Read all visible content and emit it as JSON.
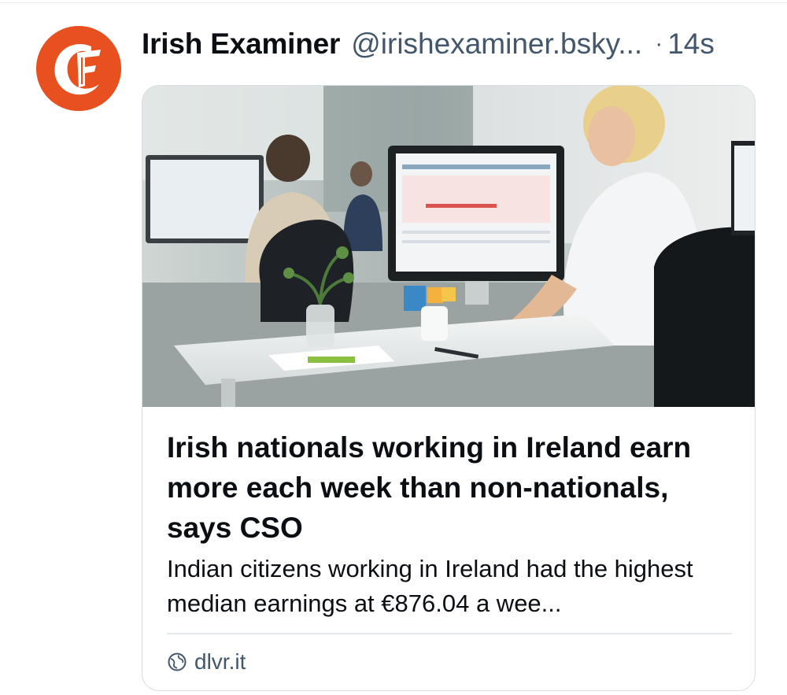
{
  "post": {
    "author_name": "Irish Examiner",
    "author_handle": "@irishexaminer.bsky...",
    "separator": "·",
    "timestamp": "14s",
    "avatar_icon": "irish-examiner-logo",
    "avatar_color": "#e8501f"
  },
  "link_card": {
    "image_icon": "office-workers-photo",
    "title": "Irish nationals working in Ireland earn more each week than non-nationals, says CSO",
    "description": "Indian citizens working in Ireland had the highest median earnings at €876.04 a wee...",
    "domain_icon": "globe-icon",
    "domain": "dlvr.it"
  },
  "colors": {
    "text_primary": "#0b0f14",
    "text_secondary": "#42576c",
    "border": "#d6dde3"
  }
}
